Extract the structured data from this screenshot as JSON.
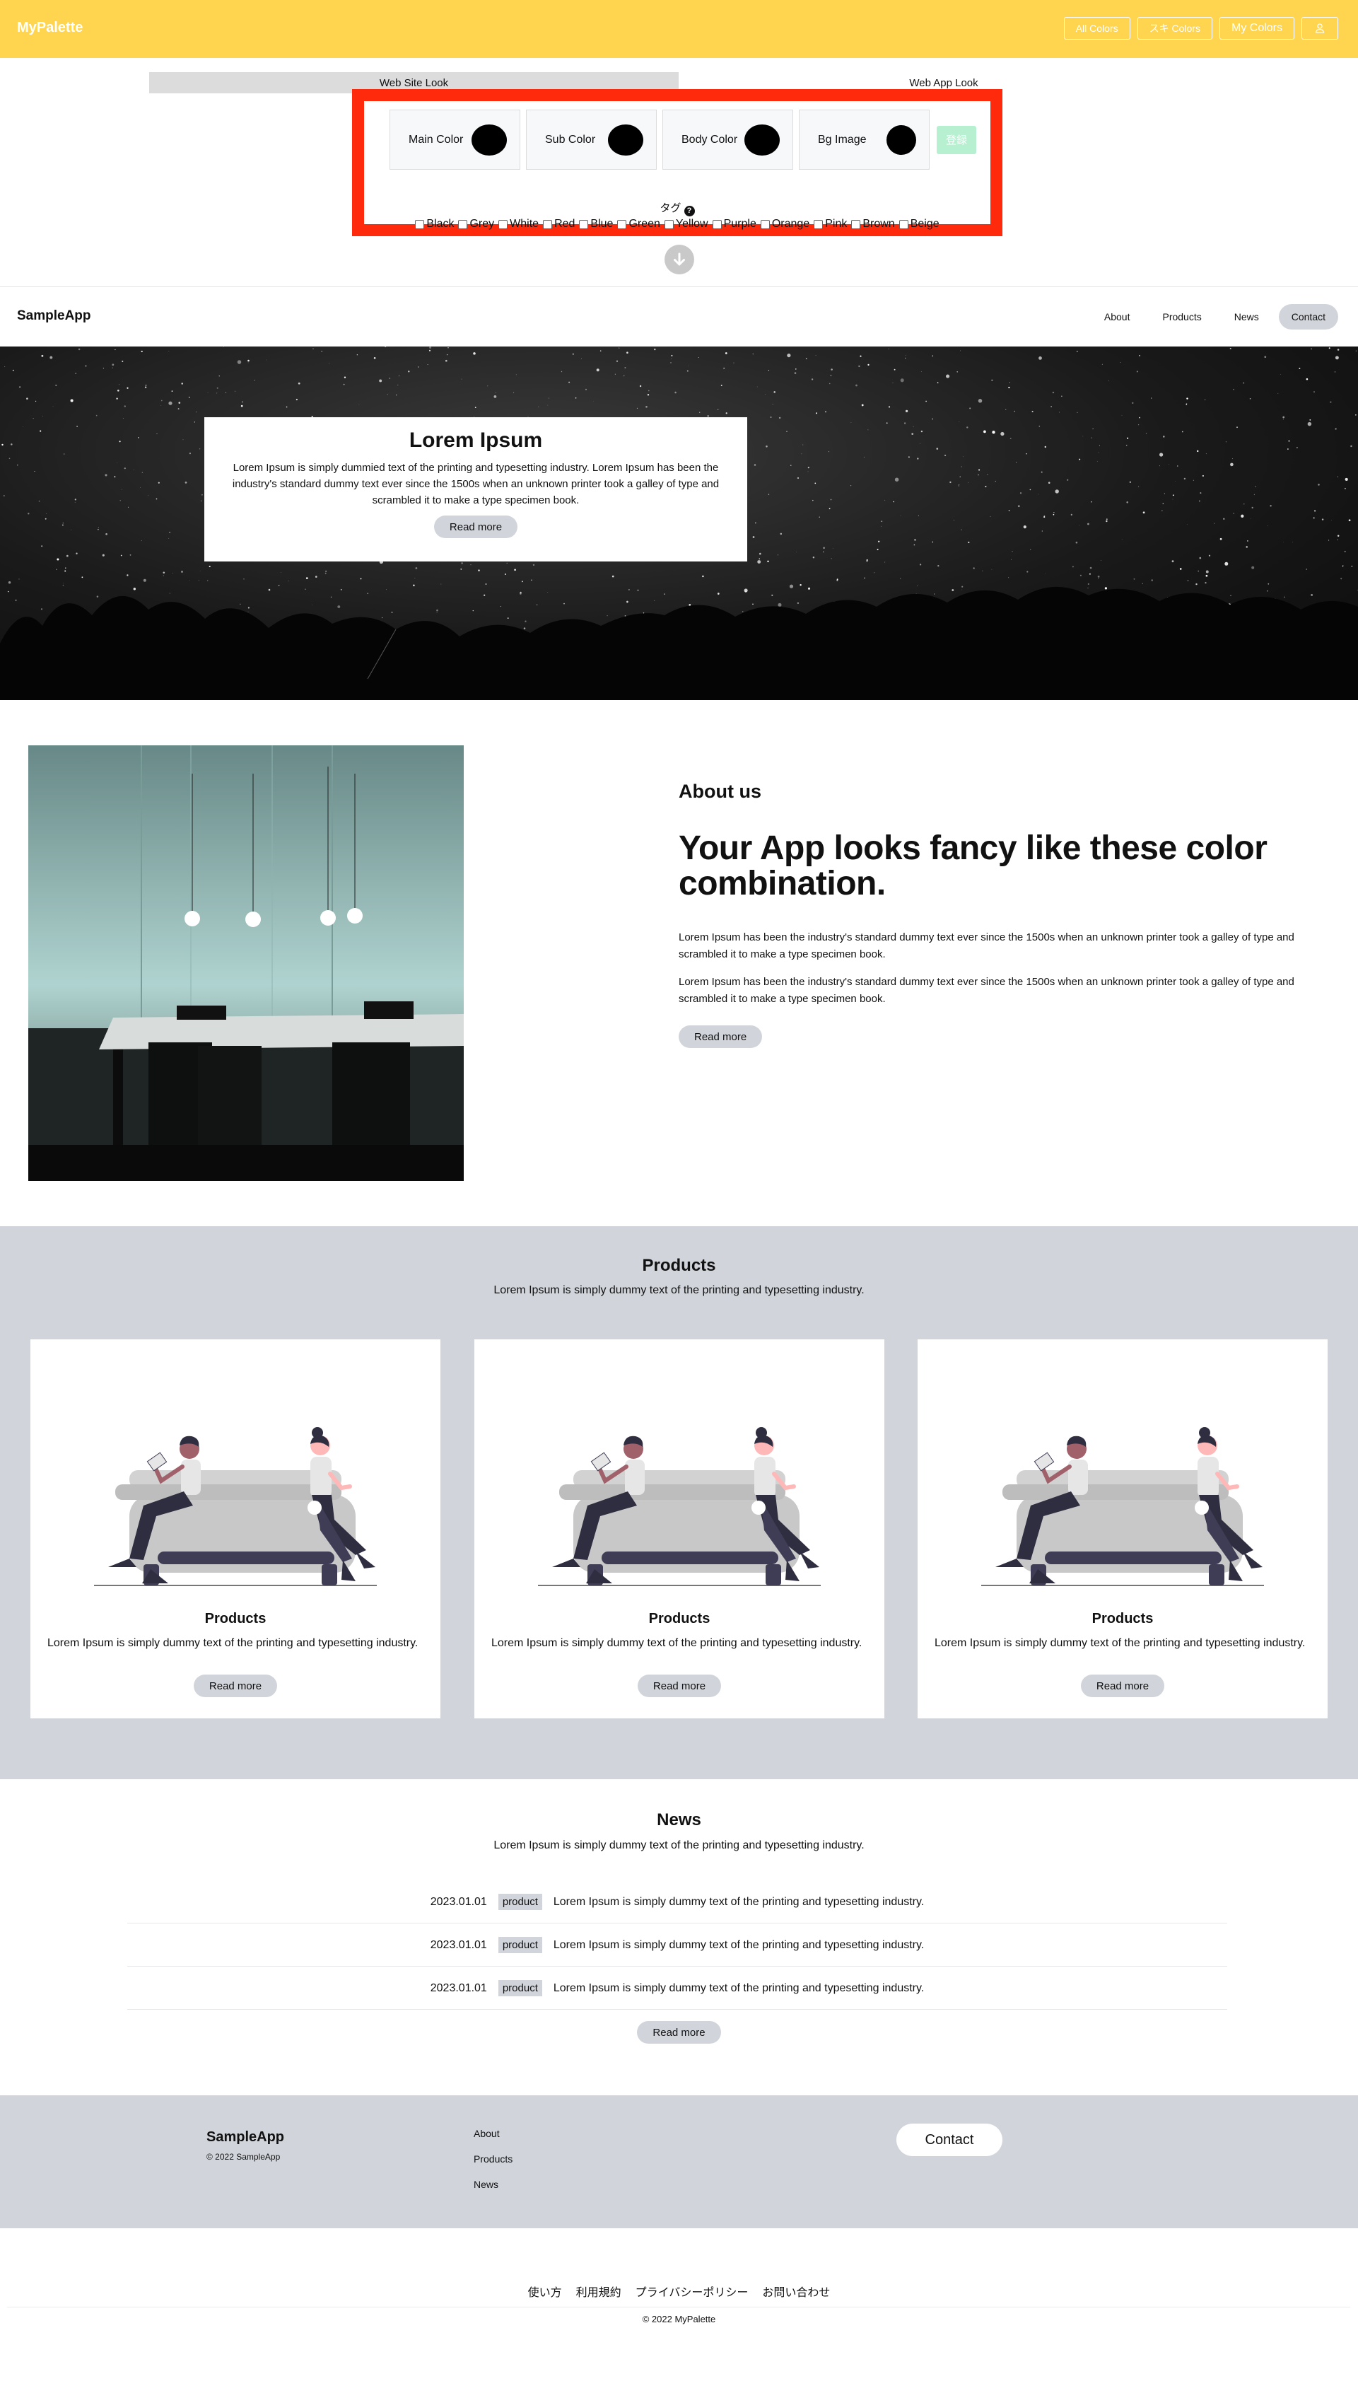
{
  "header": {
    "brand": "MyPalette",
    "nav": [
      "All Colors",
      "スキ Colors",
      "My Colors"
    ],
    "user_icon": "user-icon",
    "bg_color": "#ffd54f"
  },
  "view_tabs": {
    "active": "Web Site Look",
    "inactive": "Web App Look"
  },
  "palette_editor": {
    "slots": [
      {
        "label": "Main Color",
        "color": "#000000"
      },
      {
        "label": "Sub Color",
        "color": "#000000"
      },
      {
        "label": "Body Color",
        "color": "#000000"
      },
      {
        "label": "Bg Image",
        "color": "#000000"
      }
    ],
    "register_label": "登録",
    "tag_heading": "タグ",
    "help_icon": "question-circle-icon",
    "tags": [
      "Black",
      "Grey",
      "White",
      "Red",
      "Blue",
      "Green",
      "Yellow",
      "Purple",
      "Orange",
      "Pink",
      "Brown",
      "Beige"
    ],
    "highlight_color": "#ff2a0b",
    "scroll_icon": "arrow-down-circle-icon"
  },
  "sample_app": {
    "brand": "SampleApp",
    "menu": [
      "About",
      "Products",
      "News",
      "Contact"
    ],
    "hero": {
      "title": "Lorem Ipsum",
      "text": "Lorem Ipsum is simply dummied text of the printing and typesetting industry. Lorem Ipsum has been the industry's standard dummy text ever since the 1500s when an unknown printer took a galley of type and scrambled it to make a type specimen book.",
      "button": "Read more"
    },
    "about": {
      "subtitle": "About us",
      "title": "Your App looks fancy like these color combination.",
      "paragraphs": [
        "Lorem Ipsum has been the industry's standard dummy text ever since the 1500s when an unknown printer took a galley of type and scrambled it to make a type specimen book.",
        "Lorem Ipsum has been the industry's standard dummy text ever since the 1500s when an unknown printer took a galley of type and scrambled it to make a type specimen book."
      ],
      "button": "Read more"
    },
    "products": {
      "title": "Products",
      "description": "Lorem Ipsum is simply dummy text of the printing and typesetting industry.",
      "items": [
        {
          "title": "Products",
          "text": "Lorem Ipsum is simply dummy text of the printing and typesetting industry.",
          "button": "Read more"
        },
        {
          "title": "Products",
          "text": "Lorem Ipsum is simply dummy text of the printing and typesetting industry.",
          "button": "Read more"
        },
        {
          "title": "Products",
          "text": "Lorem Ipsum is simply dummy text of the printing and typesetting industry.",
          "button": "Read more"
        }
      ]
    },
    "news": {
      "title": "News",
      "description": "Lorem Ipsum is simply dummy text of the printing and typesetting industry.",
      "items": [
        {
          "date": "2023.01.01",
          "tag": "product",
          "text": "Lorem Ipsum is simply dummy text of the printing and typesetting industry."
        },
        {
          "date": "2023.01.01",
          "tag": "product",
          "text": "Lorem Ipsum is simply dummy text of the printing and typesetting industry."
        },
        {
          "date": "2023.01.01",
          "tag": "product",
          "text": "Lorem Ipsum is simply dummy text of the printing and typesetting industry."
        }
      ],
      "button": "Read more"
    },
    "footer": {
      "brand": "SampleApp",
      "copyright": "© 2022 SampleApp",
      "links": [
        "About",
        "Products",
        "News"
      ],
      "contact": "Contact"
    },
    "accent_gray": "#d1d5db"
  },
  "site_footer": {
    "links": [
      "使い方",
      "利用規約",
      "プライバシーポリシー",
      "お問い合わせ"
    ],
    "copyright": "© 2022 MyPalette"
  }
}
